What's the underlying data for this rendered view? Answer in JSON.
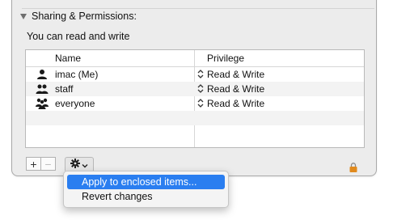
{
  "sharing": {
    "section_title": "Sharing & Permissions:",
    "access_text": "You can read and write",
    "columns": {
      "name": "Name",
      "privilege": "Privilege"
    },
    "rows": [
      {
        "name": "imac (Me)",
        "privilege": "Read & Write",
        "icon": "single-user-icon"
      },
      {
        "name": "staff",
        "privilege": "Read & Write",
        "icon": "group-icon"
      },
      {
        "name": "everyone",
        "privilege": "Read & Write",
        "icon": "everyone-icon"
      }
    ]
  },
  "toolbar": {
    "add_label": "+",
    "remove_label": "−",
    "action_icon": "gear-icon",
    "lock_icon": "lock-icon"
  },
  "menu": {
    "items": [
      {
        "label": "Apply to enclosed items...",
        "selected": true
      },
      {
        "label": "Revert changes",
        "selected": false
      }
    ]
  },
  "colors": {
    "accent": "#2a7ef0",
    "panel_bg": "#ececec",
    "lock": "#e08a1e"
  }
}
